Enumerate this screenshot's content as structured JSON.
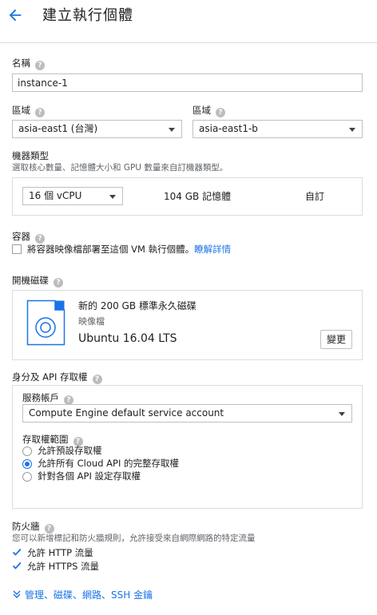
{
  "header": {
    "title": "建立執行個體"
  },
  "name": {
    "label": "名稱",
    "value": "instance-1"
  },
  "region": {
    "label": "區域",
    "value": "asia-east1 (台灣)"
  },
  "zone": {
    "label": "區域",
    "value": "asia-east1-b"
  },
  "machine_type": {
    "label": "機器類型",
    "description": "選取核心數量、記憶體大小和 GPU 數量來自訂機器類型。",
    "cpu_value": "16 個 vCPU",
    "memory": "104 GB 記憶體",
    "customize_link": "自訂"
  },
  "container": {
    "label": "容器",
    "checkbox_label": "將容器映像檔部署至這個 VM 執行個體。",
    "learn_more": "瞭解詳情",
    "checked": false
  },
  "boot_disk": {
    "label": "開機磁碟",
    "disk_desc": "新的 200 GB 標準永久磁碟",
    "image_label": "映像檔",
    "image_name": "Ubuntu 16.04 LTS",
    "change_button": "變更"
  },
  "identity": {
    "label": "身分及 API 存取權",
    "service_account_label": "服務帳戶",
    "service_account_value": "Compute Engine default service account",
    "scopes_label": "存取權範圍",
    "scopes": [
      {
        "label": "允許預設存取權",
        "selected": false
      },
      {
        "label": "允許所有 Cloud API 的完整存取權",
        "selected": true
      },
      {
        "label": "針對各個 API 設定存取權",
        "selected": false
      }
    ]
  },
  "firewall": {
    "label": "防火牆",
    "description": "您可以新增標記和防火牆規則，允許接受來自網際網路的特定流量",
    "options": [
      {
        "label": "允許 HTTP 流量",
        "checked": true
      },
      {
        "label": "允許 HTTPS 流量",
        "checked": true
      }
    ]
  },
  "more": {
    "label": "管理、磁碟、網路、SSH 金鑰"
  },
  "colors": {
    "accent": "#1a73e8",
    "border": "#dadce0",
    "text": "#212121"
  },
  "icons": [
    "back-arrow-icon",
    "help-icon",
    "dropdown-caret-icon",
    "disk-icon",
    "checkbox-icon",
    "radio-icon",
    "chevron-double-down-icon"
  ]
}
